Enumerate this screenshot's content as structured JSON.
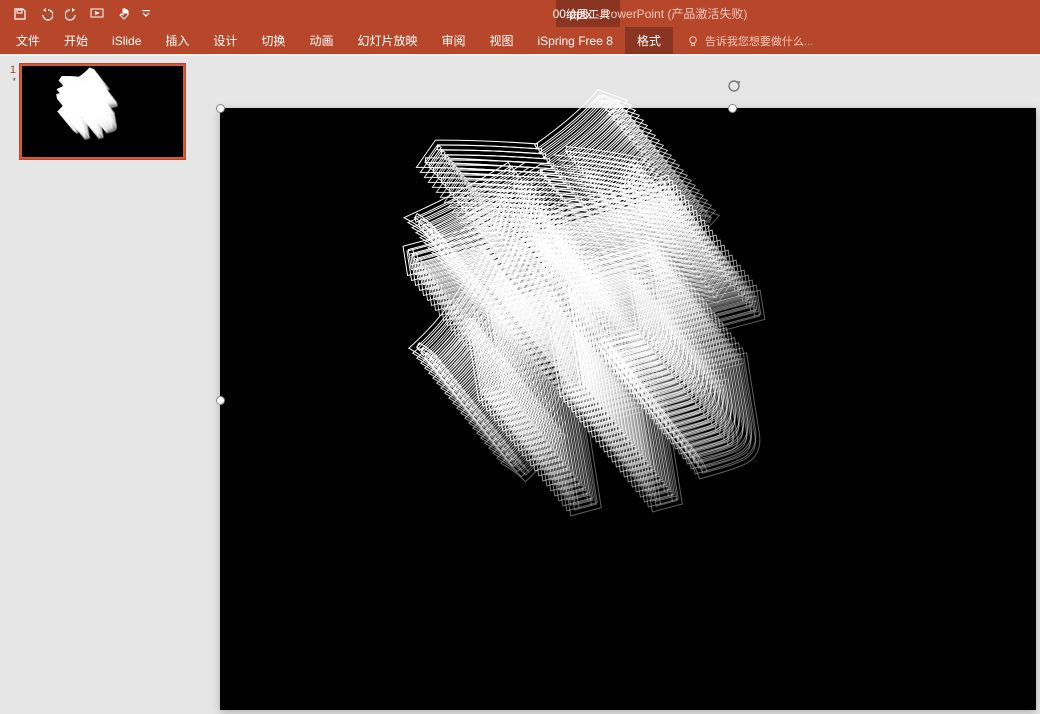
{
  "window": {
    "filename": "00.pptx",
    "app": "PowerPoint",
    "status": "(产品激活失败)",
    "tool_context": "绘图工具"
  },
  "tabs": {
    "file": "文件",
    "home": "开始",
    "islide": "iSlide",
    "insert": "插入",
    "design": "设计",
    "transitions": "切换",
    "animations": "动画",
    "slideshow": "幻灯片放映",
    "review": "审阅",
    "view": "视图",
    "ispring": "iSpring Free 8",
    "format": "格式"
  },
  "tellme": {
    "placeholder": "告诉我您想要做什么..."
  },
  "thumbs": {
    "items": [
      {
        "index": "1",
        "modified": "*"
      }
    ]
  },
  "art": {
    "char": "希",
    "copies": 24
  }
}
